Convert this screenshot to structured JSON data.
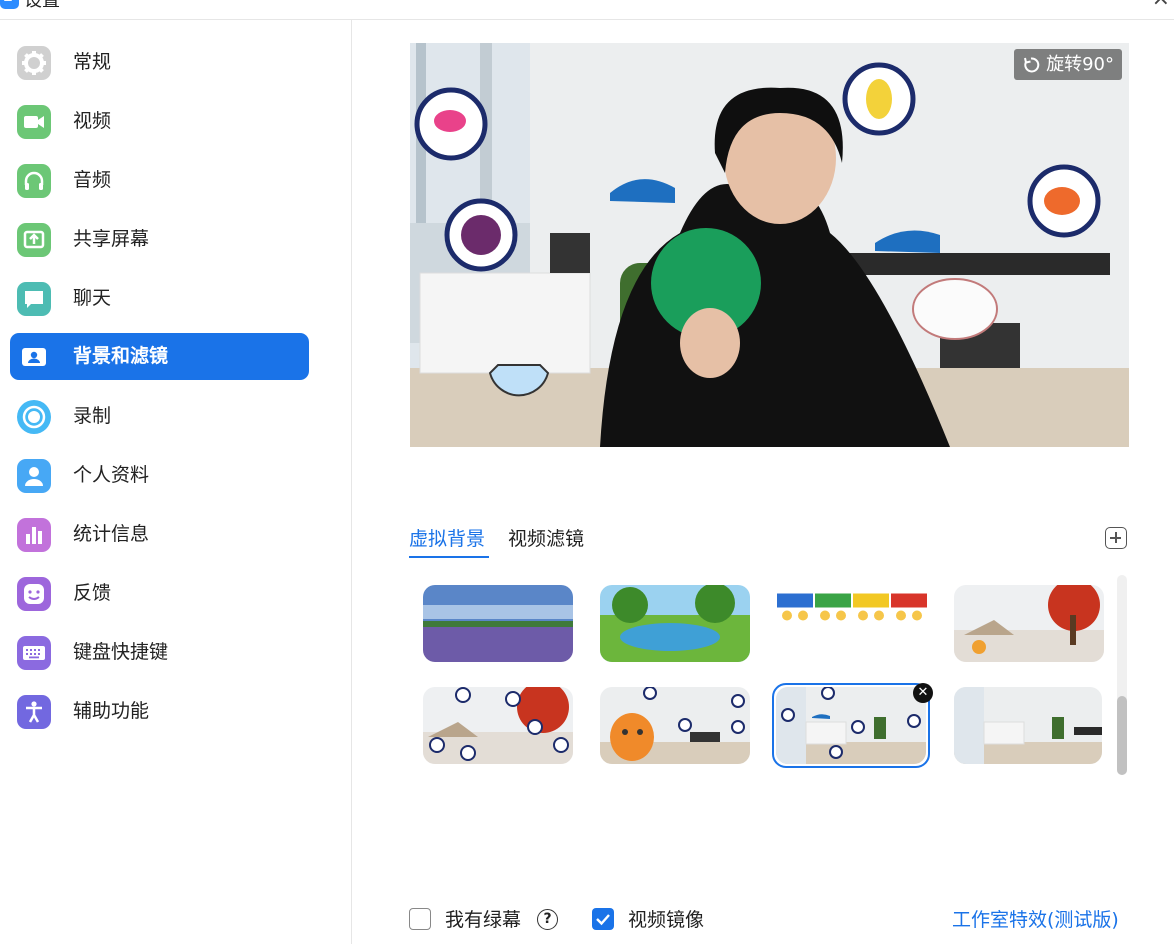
{
  "window": {
    "title": "设置",
    "close_glyph": "×"
  },
  "sidebar": {
    "items": [
      {
        "label": "常规",
        "icon": "gear-icon",
        "color": "#c8c8c8"
      },
      {
        "label": "视频",
        "icon": "video-camera-icon",
        "color": "#5cc26a"
      },
      {
        "label": "音频",
        "icon": "headphones-icon",
        "color": "#5cc26a"
      },
      {
        "label": "共享屏幕",
        "icon": "share-screen-icon",
        "color": "#5cc26a"
      },
      {
        "label": "聊天",
        "icon": "chat-bubble-icon",
        "color": "#42b8b0"
      },
      {
        "label": "背景和滤镜",
        "icon": "background-person-icon",
        "color": "#ffffff",
        "active": true
      },
      {
        "label": "录制",
        "icon": "record-icon",
        "color": "#3fb6f5"
      },
      {
        "label": "个人资料",
        "icon": "profile-person-icon",
        "color": "#3fa3f5"
      },
      {
        "label": "统计信息",
        "icon": "statistics-bars-icon",
        "color": "#c06ed8"
      },
      {
        "label": "反馈",
        "icon": "feedback-smile-icon",
        "color": "#9a63db"
      },
      {
        "label": "键盘快捷键",
        "icon": "keyboard-icon",
        "color": "#8a6ae0"
      },
      {
        "label": "辅助功能",
        "icon": "accessibility-icon",
        "color": "#7166e0"
      }
    ]
  },
  "preview": {
    "rotate_label": "旋转90°"
  },
  "tabs": [
    {
      "label": "虚拟背景",
      "active": true
    },
    {
      "label": "视频滤镜",
      "active": false
    }
  ],
  "thumbnails": [
    {
      "name": "lavender-field"
    },
    {
      "name": "cartoon-pond"
    },
    {
      "name": "emotion-zones-chart"
    },
    {
      "name": "red-tree-winter"
    },
    {
      "name": "red-tree-icons"
    },
    {
      "name": "cat-classroom"
    },
    {
      "name": "clinic-room-stickers",
      "selected": true
    },
    {
      "name": "clinic-room"
    }
  ],
  "controls": {
    "green_screen_label": "我有绿幕",
    "green_screen_checked": false,
    "help_glyph": "?",
    "mirror_label": "视频镜像",
    "mirror_checked": true,
    "studio_effects_label": "工作室特效(测试版)"
  },
  "colors": {
    "accent": "#1a73e8"
  }
}
